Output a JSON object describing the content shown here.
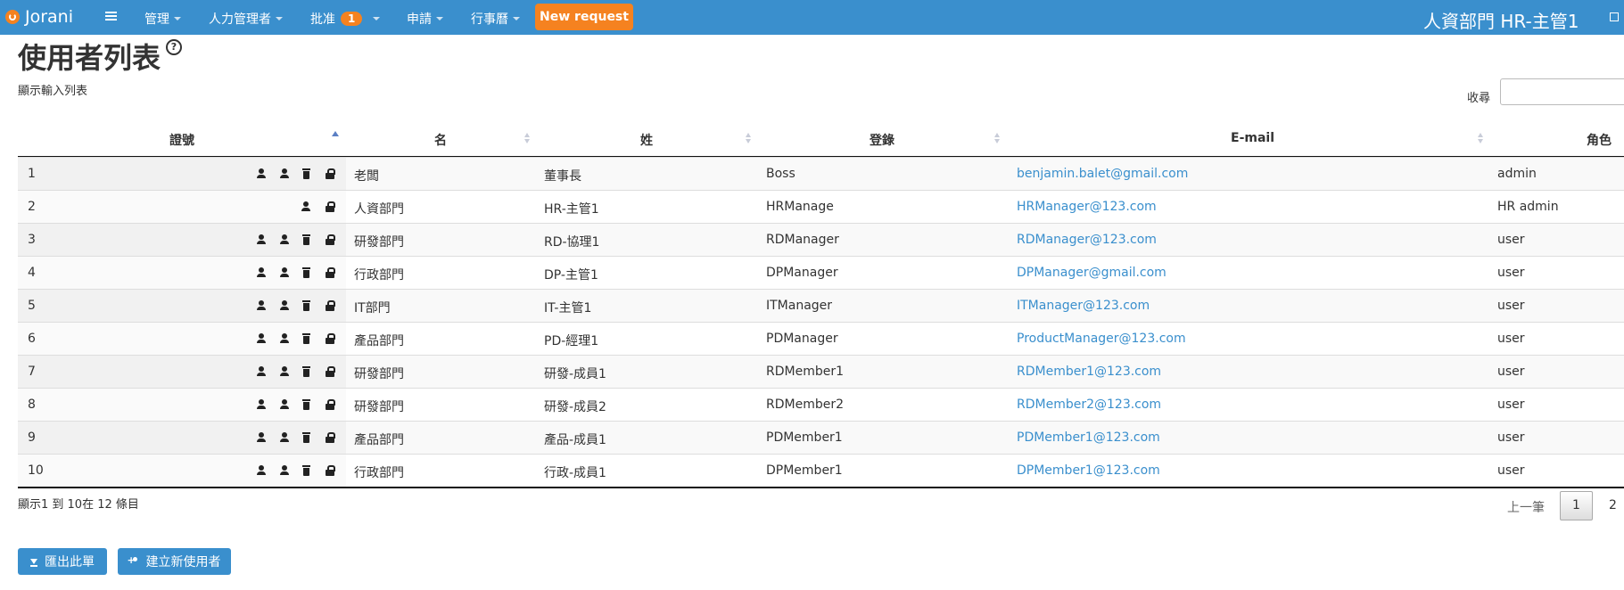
{
  "nav": {
    "brand": "Jorani",
    "menu": [
      {
        "label": "管理"
      },
      {
        "label": "人力管理者"
      },
      {
        "label": "批准",
        "badge": "1"
      },
      {
        "label": "申請"
      },
      {
        "label": "行事曆"
      }
    ],
    "new_request": "New request",
    "user": "人資部門 HR-主管1"
  },
  "page": {
    "title": "使用者列表",
    "subtitle": "顯示輸入列表",
    "search_label": "收尋",
    "search_value": ""
  },
  "table": {
    "columns": [
      "證號",
      "名",
      "姓",
      "登錄",
      "E-mail",
      "角色"
    ],
    "rows": [
      {
        "id": "1",
        "first": "老闆",
        "last": "董事長",
        "login": "Boss",
        "email": "benjamin.balet@gmail.com",
        "role": "admin"
      },
      {
        "id": "2",
        "first": "人資部門",
        "last": "HR-主管1",
        "login": "HRManage",
        "email": "HRManager@123.com",
        "role": "HR admin"
      },
      {
        "id": "3",
        "first": "研發部門",
        "last": "RD-協理1",
        "login": "RDManager",
        "email": "RDManager@123.com",
        "role": "user"
      },
      {
        "id": "4",
        "first": "行政部門",
        "last": "DP-主管1",
        "login": "DPManager",
        "email": "DPManager@gmail.com",
        "role": "user"
      },
      {
        "id": "5",
        "first": "IT部門",
        "last": "IT-主管1",
        "login": "ITManager",
        "email": "ITManager@123.com",
        "role": "user"
      },
      {
        "id": "6",
        "first": "產品部門",
        "last": "PD-經理1",
        "login": "PDManager",
        "email": "ProductManager@123.com",
        "role": "user"
      },
      {
        "id": "7",
        "first": "研發部門",
        "last": "研發-成員1",
        "login": "RDMember1",
        "email": "RDMember1@123.com",
        "role": "user"
      },
      {
        "id": "8",
        "first": "研發部門",
        "last": "研發-成員2",
        "login": "RDMember2",
        "email": "RDMember2@123.com",
        "role": "user"
      },
      {
        "id": "9",
        "first": "產品部門",
        "last": "產品-成員1",
        "login": "PDMember1",
        "email": "PDMember1@123.com",
        "role": "user"
      },
      {
        "id": "10",
        "first": "行政部門",
        "last": "行政-成員1",
        "login": "DPMember1",
        "email": "DPMember1@123.com",
        "role": "user"
      }
    ]
  },
  "footer": {
    "info": "顯示1 到 10在 12 條目",
    "prev": "上一筆",
    "pages": [
      "1",
      "2"
    ],
    "export": "匯出此單",
    "create": "建立新使用者"
  },
  "colors": {
    "navbar": "#3a8fcd",
    "accent": "#f58220",
    "link": "#3a8fcd"
  }
}
